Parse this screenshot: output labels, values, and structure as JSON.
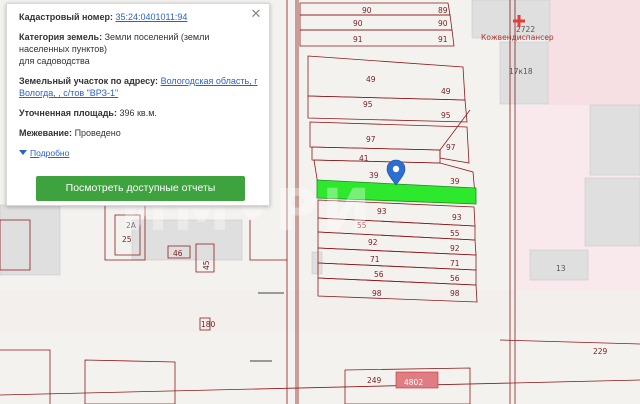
{
  "map": {
    "watermark": "ИМ•РИ",
    "plot_labels": {
      "r90": "90",
      "r89": "89",
      "r90b": "90",
      "r90c": "90",
      "r91": "91",
      "r91b": "91",
      "r49a": "49",
      "r49b": "49",
      "r95a": "95",
      "r95b": "95",
      "r97a": "97",
      "r97b": "97",
      "r41": "41",
      "r39a": "39",
      "r39b": "39",
      "r93a": "93",
      "r93b": "93",
      "r55a": "55",
      "r55b": "55",
      "r92a": "92",
      "r92b": "92",
      "r71a": "71",
      "r71b": "71",
      "r56a": "56",
      "r56b": "56",
      "r98a": "98",
      "r98b": "98",
      "b2722": "2722",
      "clinic": "Кожвендиспансер",
      "b17k18": "17к18",
      "b13": "13",
      "b229": "229",
      "b249": "249",
      "b4802": "4802",
      "b180": "180",
      "b45": "45",
      "b46": "46",
      "b25": "25",
      "b2a": "2А"
    }
  },
  "popup": {
    "cadastral_label": "Кадастровый номер:",
    "cadastral_number": "35:24:0401011:94",
    "category_label": "Категория земель:",
    "category_value_line1": "Земли поселений (земли",
    "category_value_line2": "населенных пунктов)",
    "category_value_line3": "для садоводства",
    "address_label": "Земельный участок по адресу:",
    "address_value_line1": "Вологодская область, г",
    "address_value_line2": "Вологда, , с/тов \"ВРЗ-1\"",
    "area_label": "Уточненная площадь:",
    "area_value": "396 кв.м.",
    "survey_label": "Межевание:",
    "survey_value": "Проведено",
    "more_link": "Подробно",
    "reports_button": "Посмотреть доступные отчеты",
    "close_glyph": "✕"
  },
  "colors": {
    "highlight": "#2ee82e",
    "accent_button": "#3ea33f",
    "pin": "#2d6fd1",
    "parcel_line": "#8b1a1a",
    "link": "#2a62c9"
  }
}
